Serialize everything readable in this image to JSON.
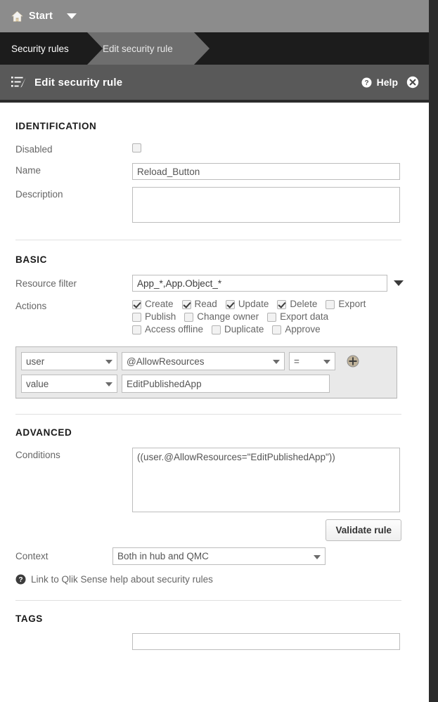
{
  "topbar": {
    "home_icon": "home-icon",
    "start_label": "Start",
    "caret_icon": "chevron-down-icon"
  },
  "breadcrumb": {
    "items": [
      {
        "label": "Security rules",
        "active": false
      },
      {
        "label": "Edit security rule",
        "active": true
      }
    ]
  },
  "panel_header": {
    "icon": "edit-list-icon",
    "title": "Edit security rule",
    "help_label": "Help",
    "help_icon": "question-circle-icon",
    "close_icon": "close-circle-icon"
  },
  "identification": {
    "title": "IDENTIFICATION",
    "disabled_label": "Disabled",
    "disabled_checked": false,
    "name_label": "Name",
    "name_value": "Reload_Button",
    "description_label": "Description",
    "description_value": ""
  },
  "basic": {
    "title": "BASIC",
    "resource_filter_label": "Resource filter",
    "resource_filter_value": "App_*,App.Object_*",
    "resource_filter_caret": "chevron-down-icon",
    "actions_label": "Actions",
    "actions": [
      {
        "label": "Create",
        "checked": true
      },
      {
        "label": "Read",
        "checked": true
      },
      {
        "label": "Update",
        "checked": true
      },
      {
        "label": "Delete",
        "checked": true
      },
      {
        "label": "Export",
        "checked": false
      },
      {
        "label": "Publish",
        "checked": false
      },
      {
        "label": "Change owner",
        "checked": false
      },
      {
        "label": "Export data",
        "checked": false
      },
      {
        "label": "Access offline",
        "checked": false
      },
      {
        "label": "Duplicate",
        "checked": false
      },
      {
        "label": "Approve",
        "checked": false
      }
    ]
  },
  "condition_builder": {
    "row1": {
      "subject": "user",
      "property": "@AllowResources",
      "operator": "="
    },
    "row2": {
      "kind": "value",
      "value": "EditPublishedApp"
    },
    "add_icon": "plus-circle-icon"
  },
  "advanced": {
    "title": "ADVANCED",
    "conditions_label": "Conditions",
    "conditions_value": "((user.@AllowResources=\"EditPublishedApp\"))",
    "validate_button": "Validate rule",
    "context_label": "Context",
    "context_value": "Both in hub and QMC",
    "help_link_text": "Link to Qlik Sense help about security rules",
    "help_link_icon": "question-circle-icon"
  },
  "tags": {
    "title": "TAGS",
    "value": "",
    "placeholder": ""
  },
  "colors": {
    "topbar_bg": "#8c8c8c",
    "breadcrumb_bg": "#1c1c1c",
    "breadcrumb_active_bg": "#6e6e6e",
    "panel_header_bg": "#595959",
    "content_bg": "#ffffff",
    "rail_bg": "#2b2b2b",
    "label_text": "#666666",
    "input_border": "#bdbdbd"
  }
}
